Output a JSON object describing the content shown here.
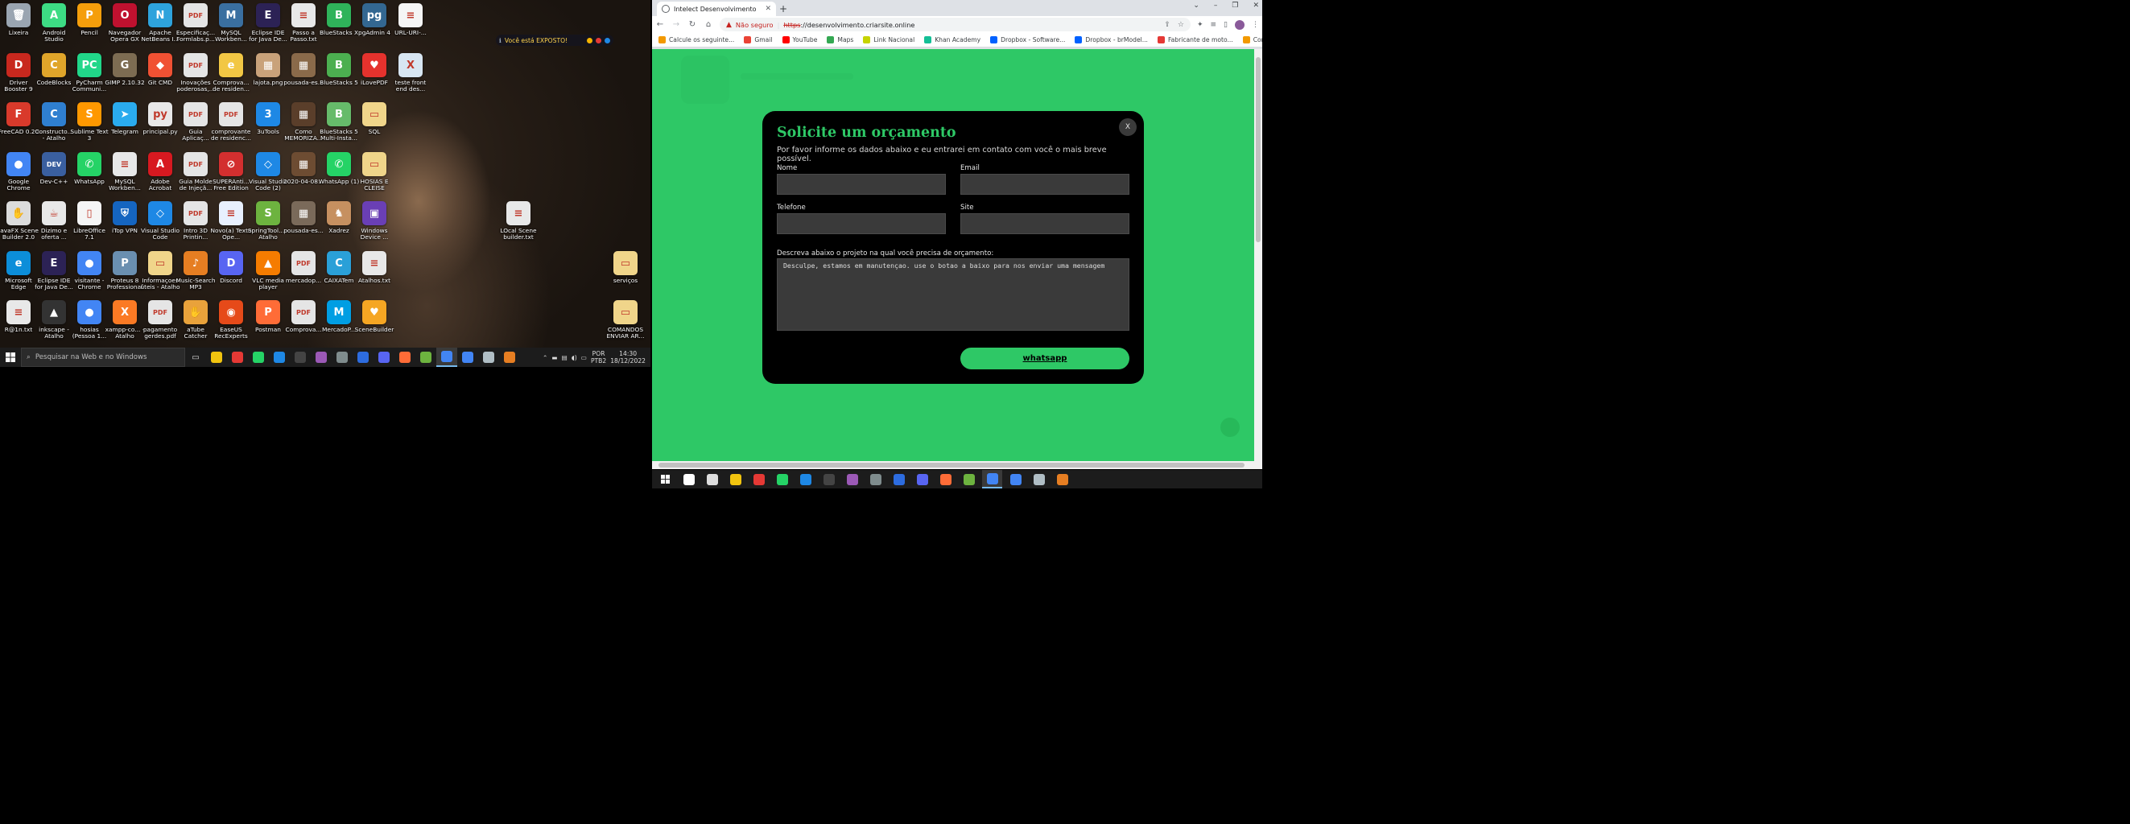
{
  "desktop": {
    "icons": [
      {
        "label": "Lixeira",
        "color": "#9aa5b1",
        "glyph": "🗑"
      },
      {
        "label": "Android Studio",
        "color": "#3ddc84",
        "glyph": "A"
      },
      {
        "label": "Pencil",
        "color": "#f59e0b",
        "glyph": "P"
      },
      {
        "label": "Navegador Opera GX",
        "color": "#c0112f",
        "glyph": "O"
      },
      {
        "label": "Apache NetBeans I...",
        "color": "#2ea3dc",
        "glyph": "N"
      },
      {
        "label": "Especificaç... Formlabs.p...",
        "color": "#e5e5e5",
        "glyph": "PDF"
      },
      {
        "label": "MySQL Workben...",
        "color": "#3a6fa0",
        "glyph": "M"
      },
      {
        "label": "Eclipse IDE for Java De...",
        "color": "#2c2255",
        "glyph": "E"
      },
      {
        "label": "Passo a Passo.txt",
        "color": "#e8e8e8",
        "glyph": "≡"
      },
      {
        "label": "BlueStacks X",
        "color": "#2fb35a",
        "glyph": "B"
      },
      {
        "label": "pgAdmin 4",
        "color": "#336791",
        "glyph": "pg"
      },
      {
        "label": "URL-URI-...",
        "color": "#f5f5f5",
        "glyph": "≡"
      },
      {
        "label": "Driver Booster 9",
        "color": "#c8281e",
        "glyph": "D"
      },
      {
        "label": "CodeBlocks",
        "color": "#e0a52a",
        "glyph": "C"
      },
      {
        "label": "PyCharm Communi...",
        "color": "#21d789",
        "glyph": "PC"
      },
      {
        "label": "GIMP 2.10.32",
        "color": "#7d6c52",
        "glyph": "G"
      },
      {
        "label": "Git CMD",
        "color": "#f05133",
        "glyph": "◆"
      },
      {
        "label": "Inovações poderosas,...",
        "color": "#e5e5e5",
        "glyph": "PDF"
      },
      {
        "label": "Comprova... de residen...",
        "color": "#f2c744",
        "glyph": "e"
      },
      {
        "label": "lajota.png",
        "color": "#c9a27a",
        "glyph": "▦"
      },
      {
        "label": "pousada-es...",
        "color": "#8a6a4a",
        "glyph": "▦"
      },
      {
        "label": "BlueStacks 5",
        "color": "#4caf50",
        "glyph": "B"
      },
      {
        "label": "iLovePDF",
        "color": "#e5322d",
        "glyph": "♥"
      },
      {
        "label": "teste front end des...",
        "color": "#d8e6f2",
        "glyph": "X"
      },
      {
        "label": "FreeCAD 0.20",
        "color": "#d93a2b",
        "glyph": "F"
      },
      {
        "label": "Constructo... - Atalho",
        "color": "#2f7fd0",
        "glyph": "C"
      },
      {
        "label": "Sublime Text 3",
        "color": "#ff9800",
        "glyph": "S"
      },
      {
        "label": "Telegram",
        "color": "#2aabee",
        "glyph": "➤"
      },
      {
        "label": "principal.py",
        "color": "#e8e8e8",
        "glyph": "py"
      },
      {
        "label": "Guia Aplicaç...",
        "color": "#e5e5e5",
        "glyph": "PDF"
      },
      {
        "label": "comprovante de residenc...",
        "color": "#e5e5e5",
        "glyph": "PDF"
      },
      {
        "label": "3uTools",
        "color": "#1e88e5",
        "glyph": "3"
      },
      {
        "label": "Como MEMORIZA...",
        "color": "#5a3e2a",
        "glyph": "▦"
      },
      {
        "label": "BlueStacks 5 Multi-Insta...",
        "color": "#66bb6a",
        "glyph": "B"
      },
      {
        "label": "SQL",
        "color": "#f0d58a",
        "glyph": "▭"
      },
      {
        "label": "Google Chrome",
        "color": "#4285f4",
        "glyph": "●"
      },
      {
        "label": "Dev-C++",
        "color": "#3a5f9f",
        "glyph": "DEV"
      },
      {
        "label": "WhatsApp",
        "color": "#25d366",
        "glyph": "✆"
      },
      {
        "label": "MySQL Workben...",
        "color": "#e8e8e8",
        "glyph": "≡"
      },
      {
        "label": "Adobe Acrobat",
        "color": "#d71920",
        "glyph": "A"
      },
      {
        "label": "Guia Molde de Injeçã...",
        "color": "#e5e5e5",
        "glyph": "PDF"
      },
      {
        "label": "SUPERAnti... Free Edition",
        "color": "#d32f2f",
        "glyph": "⊘"
      },
      {
        "label": "Visual Studio Code (2)",
        "color": "#1e88e5",
        "glyph": "◇"
      },
      {
        "label": "2020-04-08...",
        "color": "#6d4c32",
        "glyph": "▦"
      },
      {
        "label": "WhatsApp (1)",
        "color": "#25d366",
        "glyph": "✆"
      },
      {
        "label": "HOSIAS E CLEISE",
        "color": "#f0d58a",
        "glyph": "▭"
      },
      {
        "label": "JavaFX Scene Builder 2.0",
        "color": "#dcdcdc",
        "glyph": "✋"
      },
      {
        "label": "Dizimo e oferta ...",
        "color": "#e8e8e8",
        "glyph": "☕"
      },
      {
        "label": "LibreOffice 7.1",
        "color": "#f5f5f5",
        "glyph": "▯"
      },
      {
        "label": "iTop VPN",
        "color": "#1565c0",
        "glyph": "⛨"
      },
      {
        "label": "Visual Studio Code",
        "color": "#1e88e5",
        "glyph": "◇"
      },
      {
        "label": "Intro 3D Printin...",
        "color": "#e5e5e5",
        "glyph": "PDF"
      },
      {
        "label": "Novo(a) Texto Ope...",
        "color": "#e8f0fe",
        "glyph": "≡"
      },
      {
        "label": "SpringTool... - Atalho",
        "color": "#6db33f",
        "glyph": "S"
      },
      {
        "label": "pousada-es...",
        "color": "#7a6a5a",
        "glyph": "▦"
      },
      {
        "label": "Xadrez",
        "color": "#c69060",
        "glyph": "♞"
      },
      {
        "label": "Windows Device ...",
        "color": "#6a3fb5",
        "glyph": "▣"
      },
      {
        "label": "LOcal Scene builder.txt",
        "color": "#e8e8e8",
        "glyph": "≡"
      },
      {
        "label": "Microsoft Edge",
        "color": "#0c8ed9",
        "glyph": "e"
      },
      {
        "label": "Eclipse IDE for Java De...",
        "color": "#2c2255",
        "glyph": "E"
      },
      {
        "label": "visitante - Chrome",
        "color": "#4285f4",
        "glyph": "●"
      },
      {
        "label": "Proteus 8 Professional",
        "color": "#6a8fb0",
        "glyph": "P"
      },
      {
        "label": "Informaçoes úteis - Atalho",
        "color": "#f0d58a",
        "glyph": "▭"
      },
      {
        "label": "Music-Search MP3",
        "color": "#e67e22",
        "glyph": "♪"
      },
      {
        "label": "Discord",
        "color": "#5865f2",
        "glyph": "D"
      },
      {
        "label": "VLC media player",
        "color": "#f57c00",
        "glyph": "▲"
      },
      {
        "label": "mercadop...",
        "color": "#e5e5e5",
        "glyph": "PDF"
      },
      {
        "label": "CAIXATem",
        "color": "#2aa0d8",
        "glyph": "C"
      },
      {
        "label": "Atalhos.txt",
        "color": "#e8e8e8",
        "glyph": "≡"
      },
      {
        "label": "serviços",
        "color": "#f0d58a",
        "glyph": "▭"
      },
      {
        "label": "R@1n.txt",
        "color": "#e8e8e8",
        "glyph": "≡"
      },
      {
        "label": "inkscape - Atalho",
        "color": "#333333",
        "glyph": "▲"
      },
      {
        "label": "hosias (Pessoa 1...",
        "color": "#4285f4",
        "glyph": "●"
      },
      {
        "label": "xampp-co... - Atalho",
        "color": "#fb7a24",
        "glyph": "X"
      },
      {
        "label": "pagamento gerdes.pdf",
        "color": "#e5e5e5",
        "glyph": "PDF"
      },
      {
        "label": "aTube Catcher",
        "color": "#e9a23b",
        "glyph": "✋"
      },
      {
        "label": "EaseUS RecExperts",
        "color": "#e64a19",
        "glyph": "◉"
      },
      {
        "label": "Postman",
        "color": "#ff6c37",
        "glyph": "P"
      },
      {
        "label": "Comprova...",
        "color": "#e5e5e5",
        "glyph": "PDF"
      },
      {
        "label": "MercadoP...",
        "color": "#009ee3",
        "glyph": "M"
      },
      {
        "label": "SceneBuilder",
        "color": "#f5a623",
        "glyph": "♥"
      },
      {
        "label": "COMANDOS ENVIAR AR...",
        "color": "#f0d58a",
        "glyph": "▭"
      }
    ],
    "exposed_badge": "Você está EXPOSTO!"
  },
  "taskbar_left": {
    "search_placeholder": "Pesquisar na Web e no Windows",
    "apps": [
      "#f1c40f",
      "#e53935",
      "#25d366",
      "#1e88e5",
      "#444444",
      "#9b59b6",
      "#7f8c8d",
      "#2d6cdf",
      "#5865f2",
      "#ff6c37",
      "#6db33f",
      "#4285f4",
      "#4285f4",
      "#b0bec5",
      "#e67e22"
    ],
    "active_app_index": 11,
    "lang": "POR",
    "layout": "PTB2",
    "time": "14:30",
    "date": "18/12/2022"
  },
  "browser": {
    "tab_title": "Intelect Desenvolvimento",
    "security_label": "Não seguro",
    "url_scheme": "https",
    "url_rest": "://desenvolvimento.criarsite.online",
    "bookmarks": [
      {
        "label": "Calcule os seguinte...",
        "color": "#f29900"
      },
      {
        "label": "Gmail",
        "color": "#ea4335"
      },
      {
        "label": "YouTube",
        "color": "#ff0000"
      },
      {
        "label": "Maps",
        "color": "#34a853"
      },
      {
        "label": "Link Nacional",
        "color": "#c6d300"
      },
      {
        "label": "Khan Academy",
        "color": "#14bf96"
      },
      {
        "label": "Dropbox - Software...",
        "color": "#0061ff"
      },
      {
        "label": "Dropbox - brModel...",
        "color": "#0061ff"
      },
      {
        "label": "Fabricante de moto...",
        "color": "#e53935"
      },
      {
        "label": "Construindo (build)...",
        "color": "#f29900"
      }
    ]
  },
  "modal": {
    "close_label": "X",
    "title": "Solicite um orçamento",
    "subtitle": "Por favor informe os dados abaixo e eu entrarei em contato com você o mais breve possível.",
    "fields": {
      "nome_label": "Nome",
      "email_label": "Email",
      "telefone_label": "Telefone",
      "site_label": "Site",
      "nome_value": "",
      "email_value": "",
      "telefone_value": "",
      "site_value": ""
    },
    "description_label": "Descreva abaixo o projeto na qual você precisa de orçamento:",
    "description_value": "Desculpe, estamos em manutençao. use o botao a baixo para nos enviar uma mensagem",
    "whatsapp_label": "whatsapp"
  },
  "taskbar_right": {
    "apps": [
      "#ffffff",
      "#dddddd",
      "#f1c40f",
      "#e53935",
      "#25d366",
      "#1e88e5",
      "#444444",
      "#9b59b6",
      "#7f8c8d",
      "#2d6cdf",
      "#5865f2",
      "#ff6c37",
      "#6db33f",
      "#4285f4",
      "#4285f4",
      "#b0bec5",
      "#e67e22"
    ],
    "active_app_index": 13
  },
  "colors": {
    "accent": "#2ec866",
    "modal_bg": "#000000",
    "field_bg": "#3a3a3a"
  }
}
